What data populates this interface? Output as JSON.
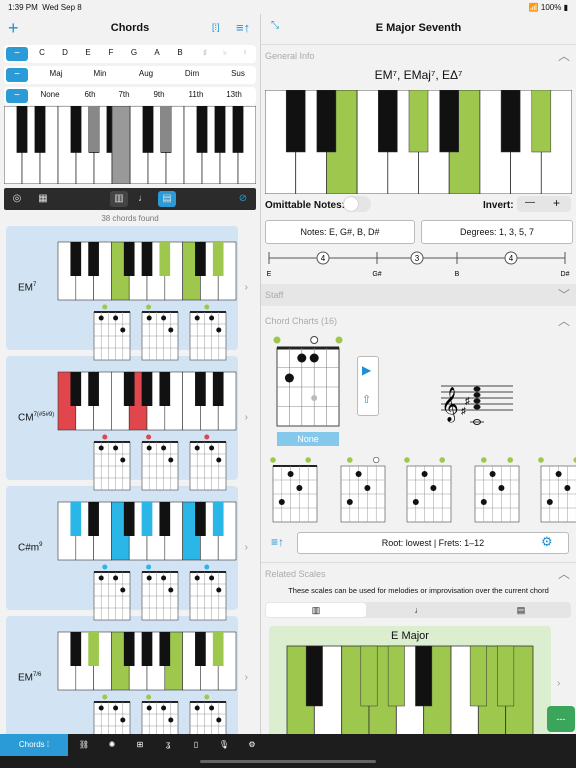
{
  "status": {
    "time": "1:39 PM",
    "date": "Wed Sep 8",
    "battery": "100%"
  },
  "left": {
    "title": "Chords",
    "header_icons": {
      "add": "plus-icon",
      "bracket": "bracket-icon",
      "sort": "sort-icon"
    },
    "roots": [
      "C",
      "D",
      "E",
      "F",
      "G",
      "A",
      "B"
    ],
    "qualities": [
      "Maj",
      "Min",
      "Aug",
      "Dim",
      "Sus"
    ],
    "extensions": [
      "None",
      "6th",
      "7th",
      "9th",
      "11th",
      "13th"
    ],
    "found": "38 chords found",
    "chords": [
      {
        "name": "EM",
        "sup": "7",
        "color": "#9ec74e"
      },
      {
        "name": "CM",
        "sup": "7(#5#9)",
        "color": "#e0464b"
      },
      {
        "name": "C#m",
        "sup": "9",
        "color": "#2ab6e6"
      },
      {
        "name": "EM",
        "sup": "7/6",
        "color": "#9ec74e"
      }
    ]
  },
  "right": {
    "title": "E Major Seventh",
    "general_info": "General Info",
    "chord_symbols": "EM⁷, EMaj⁷, EΔ⁷",
    "omittable_label": "Omittable Notes:",
    "invert_label": "Invert:",
    "invert_minus": "—",
    "invert_plus": "+",
    "notes": "Notes: E, G#, B, D#",
    "degrees": "Degrees: 1, 3, 5, 7",
    "interval_notes": [
      "E",
      "G#",
      "B",
      "D#"
    ],
    "intervals": [
      "4",
      "3",
      "4"
    ],
    "staff": "Staff",
    "chord_charts": "Chord Charts (16)",
    "voicing_button": "None",
    "root_frets": "Root: lowest  |  Frets: 1–12",
    "related_scales": "Related Scales",
    "related_desc": "These scales can be used for melodies or improvisation over the current chord",
    "scale_name": "E Major",
    "dash_button": "---"
  },
  "bottom": {
    "chords_tab": "Chords"
  }
}
